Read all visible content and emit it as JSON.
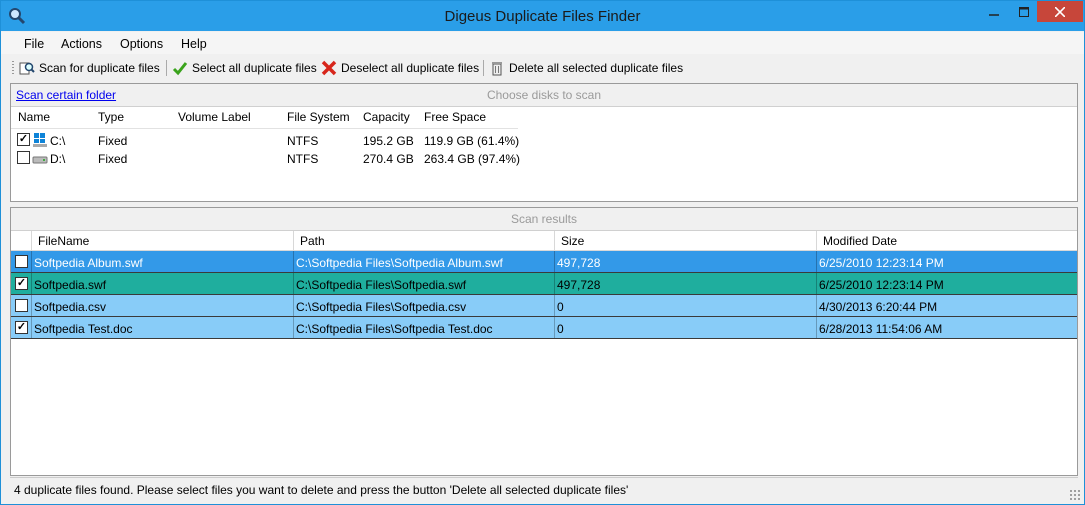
{
  "window": {
    "title": "Digeus Duplicate Files Finder"
  },
  "menu": [
    "File",
    "Actions",
    "Options",
    "Help"
  ],
  "toolbar": {
    "scan": "Scan for duplicate files",
    "select_all": "Select all duplicate files",
    "deselect_all": "Deselect all duplicate files",
    "delete_selected": "Delete all selected duplicate files"
  },
  "disks": {
    "scan_folder_link": "Scan certain folder",
    "header_label": "Choose disks to scan",
    "columns": [
      "Name",
      "Type",
      "Volume Label",
      "File System",
      "Capacity",
      "Free Space"
    ],
    "rows": [
      {
        "checked": true,
        "name": "C:\\",
        "type": "Fixed",
        "label": "",
        "fs": "NTFS",
        "capacity": "195.2 GB",
        "free": "119.9 GB (61.4%)",
        "icon": "windows-drive-icon"
      },
      {
        "checked": false,
        "name": "D:\\",
        "type": "Fixed",
        "label": "",
        "fs": "NTFS",
        "capacity": "270.4 GB",
        "free": "263.4 GB (97.4%)",
        "icon": "drive-icon"
      }
    ]
  },
  "results": {
    "header_label": "Scan results",
    "columns": [
      "FileName",
      "Path",
      "Size",
      "Modified Date"
    ],
    "rows": [
      {
        "checked": false,
        "name": "Softpedia Album.swf",
        "path": "C:\\Softpedia Files\\Softpedia Album.swf",
        "size": "497,728",
        "date": "6/25/2010 12:23:14 PM",
        "color": "#3399e8",
        "text_color": "#ffffff"
      },
      {
        "checked": true,
        "name": "Softpedia.swf",
        "path": "C:\\Softpedia Files\\Softpedia.swf",
        "size": "497,728",
        "date": "6/25/2010 12:23:14 PM",
        "color": "#1fae9e",
        "text_color": "#000000"
      },
      {
        "checked": false,
        "name": "Softpedia.csv",
        "path": "C:\\Softpedia Files\\Softpedia.csv",
        "size": "0",
        "date": "4/30/2013 6:20:44 PM",
        "color": "#88ccf8",
        "text_color": "#000000"
      },
      {
        "checked": true,
        "name": "Softpedia Test.doc",
        "path": "C:\\Softpedia Files\\Softpedia Test.doc",
        "size": "0",
        "date": "6/28/2013 11:54:06 AM",
        "color": "#88ccf8",
        "text_color": "#000000"
      }
    ]
  },
  "status": {
    "text": "4 duplicate files found. Please select files you want to delete and press the button 'Delete all selected duplicate files'"
  },
  "colors": {
    "titlebar": "#2a9ee8",
    "close": "#c7463a"
  }
}
